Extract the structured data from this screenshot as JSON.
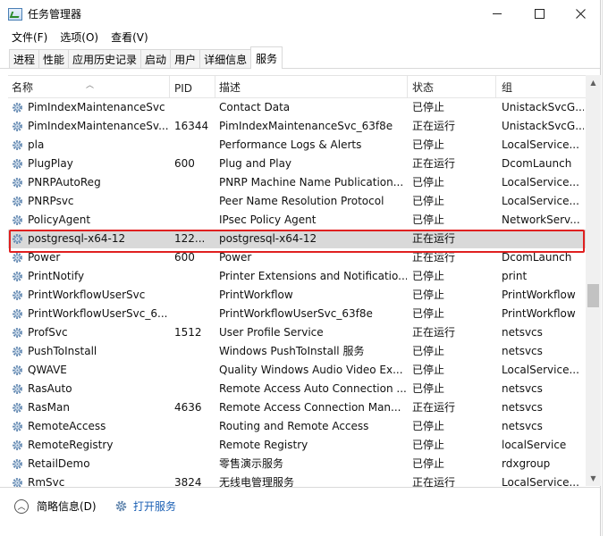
{
  "window": {
    "title": "任务管理器"
  },
  "menu": [
    {
      "label": "文件(F)"
    },
    {
      "label": "选项(O)"
    },
    {
      "label": "查看(V)"
    }
  ],
  "tabs": [
    {
      "label": "进程",
      "active": false
    },
    {
      "label": "性能",
      "active": false
    },
    {
      "label": "应用历史记录",
      "active": false
    },
    {
      "label": "启动",
      "active": false
    },
    {
      "label": "用户",
      "active": false
    },
    {
      "label": "详细信息",
      "active": false
    },
    {
      "label": "服务",
      "active": true
    }
  ],
  "columns": {
    "name": "名称",
    "pid": "PID",
    "desc": "描述",
    "state": "状态",
    "group": "组"
  },
  "rows": [
    {
      "name": "PimIndexMaintenanceSvc",
      "pid": "",
      "desc": "Contact Data",
      "state": "已停止",
      "group": "UnistackSvcG..."
    },
    {
      "name": "PimIndexMaintenanceSv...",
      "pid": "16344",
      "desc": "PimIndexMaintenanceSvc_63f8e",
      "state": "正在运行",
      "group": "UnistackSvcG..."
    },
    {
      "name": "pla",
      "pid": "",
      "desc": "Performance Logs & Alerts",
      "state": "已停止",
      "group": "LocalService..."
    },
    {
      "name": "PlugPlay",
      "pid": "600",
      "desc": "Plug and Play",
      "state": "正在运行",
      "group": "DcomLaunch"
    },
    {
      "name": "PNRPAutoReg",
      "pid": "",
      "desc": "PNRP Machine Name Publication...",
      "state": "已停止",
      "group": "LocalService..."
    },
    {
      "name": "PNRPsvc",
      "pid": "",
      "desc": "Peer Name Resolution Protocol",
      "state": "已停止",
      "group": "LocalService..."
    },
    {
      "name": "PolicyAgent",
      "pid": "",
      "desc": "IPsec Policy Agent",
      "state": "已停止",
      "group": "NetworkServ..."
    },
    {
      "name": "postgresql-x64-12",
      "pid": "122...",
      "desc": "postgresql-x64-12",
      "state": "正在运行",
      "group": "",
      "selected": true
    },
    {
      "name": "Power",
      "pid": "600",
      "desc": "Power",
      "state": "正在运行",
      "group": "DcomLaunch"
    },
    {
      "name": "PrintNotify",
      "pid": "",
      "desc": "Printer Extensions and Notificatio...",
      "state": "已停止",
      "group": "print"
    },
    {
      "name": "PrintWorkflowUserSvc",
      "pid": "",
      "desc": "PrintWorkflow",
      "state": "已停止",
      "group": "PrintWorkflow"
    },
    {
      "name": "PrintWorkflowUserSvc_6...",
      "pid": "",
      "desc": "PrintWorkflowUserSvc_63f8e",
      "state": "已停止",
      "group": "PrintWorkflow"
    },
    {
      "name": "ProfSvc",
      "pid": "1512",
      "desc": "User Profile Service",
      "state": "正在运行",
      "group": "netsvcs"
    },
    {
      "name": "PushToInstall",
      "pid": "",
      "desc": "Windows PushToInstall 服务",
      "state": "已停止",
      "group": "netsvcs"
    },
    {
      "name": "QWAVE",
      "pid": "",
      "desc": "Quality Windows Audio Video Ex...",
      "state": "已停止",
      "group": "LocalService..."
    },
    {
      "name": "RasAuto",
      "pid": "",
      "desc": "Remote Access Auto Connection ...",
      "state": "已停止",
      "group": "netsvcs"
    },
    {
      "name": "RasMan",
      "pid": "4636",
      "desc": "Remote Access Connection Man...",
      "state": "正在运行",
      "group": "netsvcs"
    },
    {
      "name": "RemoteAccess",
      "pid": "",
      "desc": "Routing and Remote Access",
      "state": "已停止",
      "group": "netsvcs"
    },
    {
      "name": "RemoteRegistry",
      "pid": "",
      "desc": "Remote Registry",
      "state": "已停止",
      "group": "localService"
    },
    {
      "name": "RetailDemo",
      "pid": "",
      "desc": "零售演示服务",
      "state": "已停止",
      "group": "rdxgroup"
    },
    {
      "name": "RmSvc",
      "pid": "3824",
      "desc": "无线电管理服务",
      "state": "正在运行",
      "group": "LocalService..."
    }
  ],
  "footer": {
    "fewer_details": "简略信息(D)",
    "open_services": "打开服务"
  },
  "colors": {
    "highlight": "#e02020",
    "link": "#1a5fb4",
    "selected_row": "#d9d9d9"
  }
}
